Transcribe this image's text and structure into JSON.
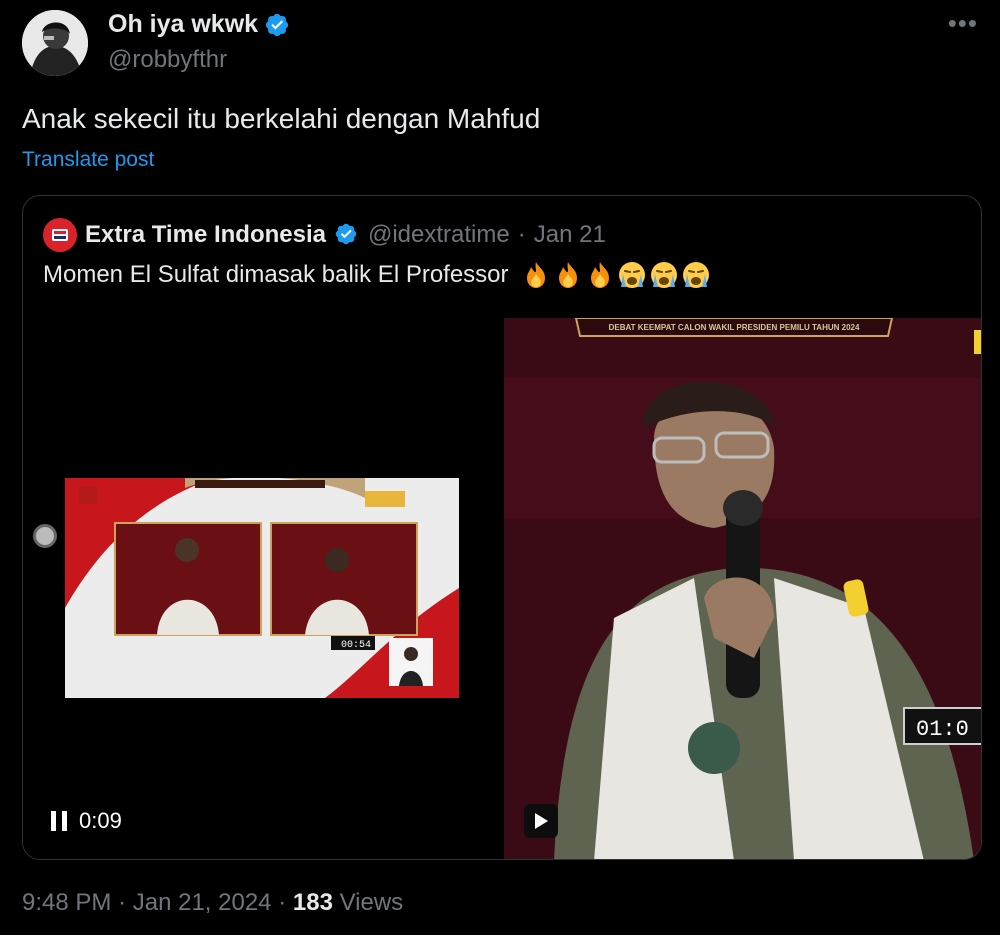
{
  "author": {
    "display_name": "Oh iya wkwk",
    "handle": "@robbyfthr",
    "verified": true,
    "avatar_icon": "profile-photo"
  },
  "post": {
    "text": "Anak sekecil itu berkelahi dengan Mahfud",
    "translate_label": "Translate post"
  },
  "quoted": {
    "display_name": "Extra Time Indonesia",
    "handle": "@idextratime",
    "separator": "·",
    "date": "Jan 21",
    "text": "Momen El Sulfat dimasak balik El Professor",
    "emojis": [
      "fire-emoji",
      "fire-emoji",
      "fire-emoji",
      "crying-emoji",
      "crying-emoji",
      "crying-emoji"
    ],
    "video": {
      "time": "0:09",
      "banner_text": "DEBAT KEEMPAT CALON WAKIL PRESIDEN PEMILU TAHUN 2024",
      "inner_timer": "00:54",
      "right_timer": "01:0"
    }
  },
  "meta": {
    "time": "9:48 PM",
    "dot": "·",
    "date": "Jan 21, 2024",
    "views_count": "183",
    "views_label": "Views"
  },
  "colors": {
    "accent": "#1d9bf0",
    "muted": "#71767b",
    "text": "#e7e9ea",
    "background": "#000000"
  }
}
